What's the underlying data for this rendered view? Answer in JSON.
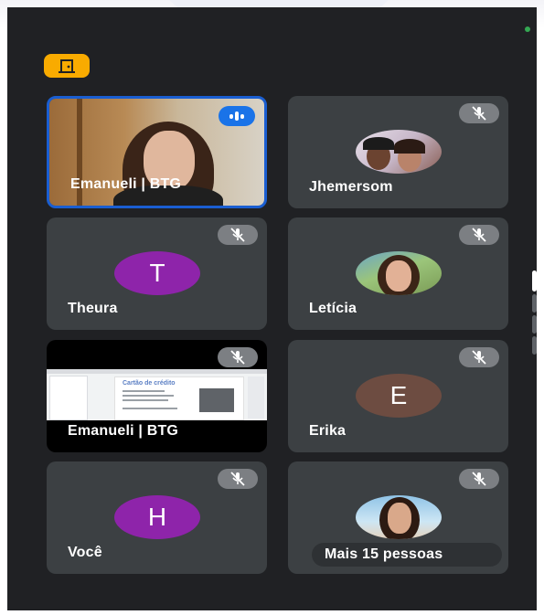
{
  "participants": [
    {
      "name": "Emanueli | BTG",
      "state": "speaking",
      "tile": "camera"
    },
    {
      "name": "Jhemersom",
      "state": "muted",
      "tile": "photo"
    },
    {
      "name": "Theura",
      "initial": "T",
      "avatar_color": "#8e24aa",
      "state": "muted"
    },
    {
      "name": "Letícia",
      "state": "muted",
      "tile": "photo"
    },
    {
      "name": "Emanueli | BTG",
      "state": "muted",
      "tile": "screen-share"
    },
    {
      "name": "Erika",
      "initial": "E",
      "avatar_color": "#6d4c41",
      "state": "muted"
    },
    {
      "name": "Você",
      "initial": "H",
      "avatar_color": "#8e24aa",
      "state": "muted"
    },
    {
      "more_label": "Mais 15 pessoas",
      "state": "muted",
      "tile": "photo"
    }
  ],
  "screen_share": {
    "slide_title": "Cartão de crédito"
  },
  "colors": {
    "background": "#202124",
    "tile": "#3c4043",
    "active_border": "#1a5ed1",
    "leave_badge": "#f9ab00",
    "status_dot": "#34a853"
  }
}
